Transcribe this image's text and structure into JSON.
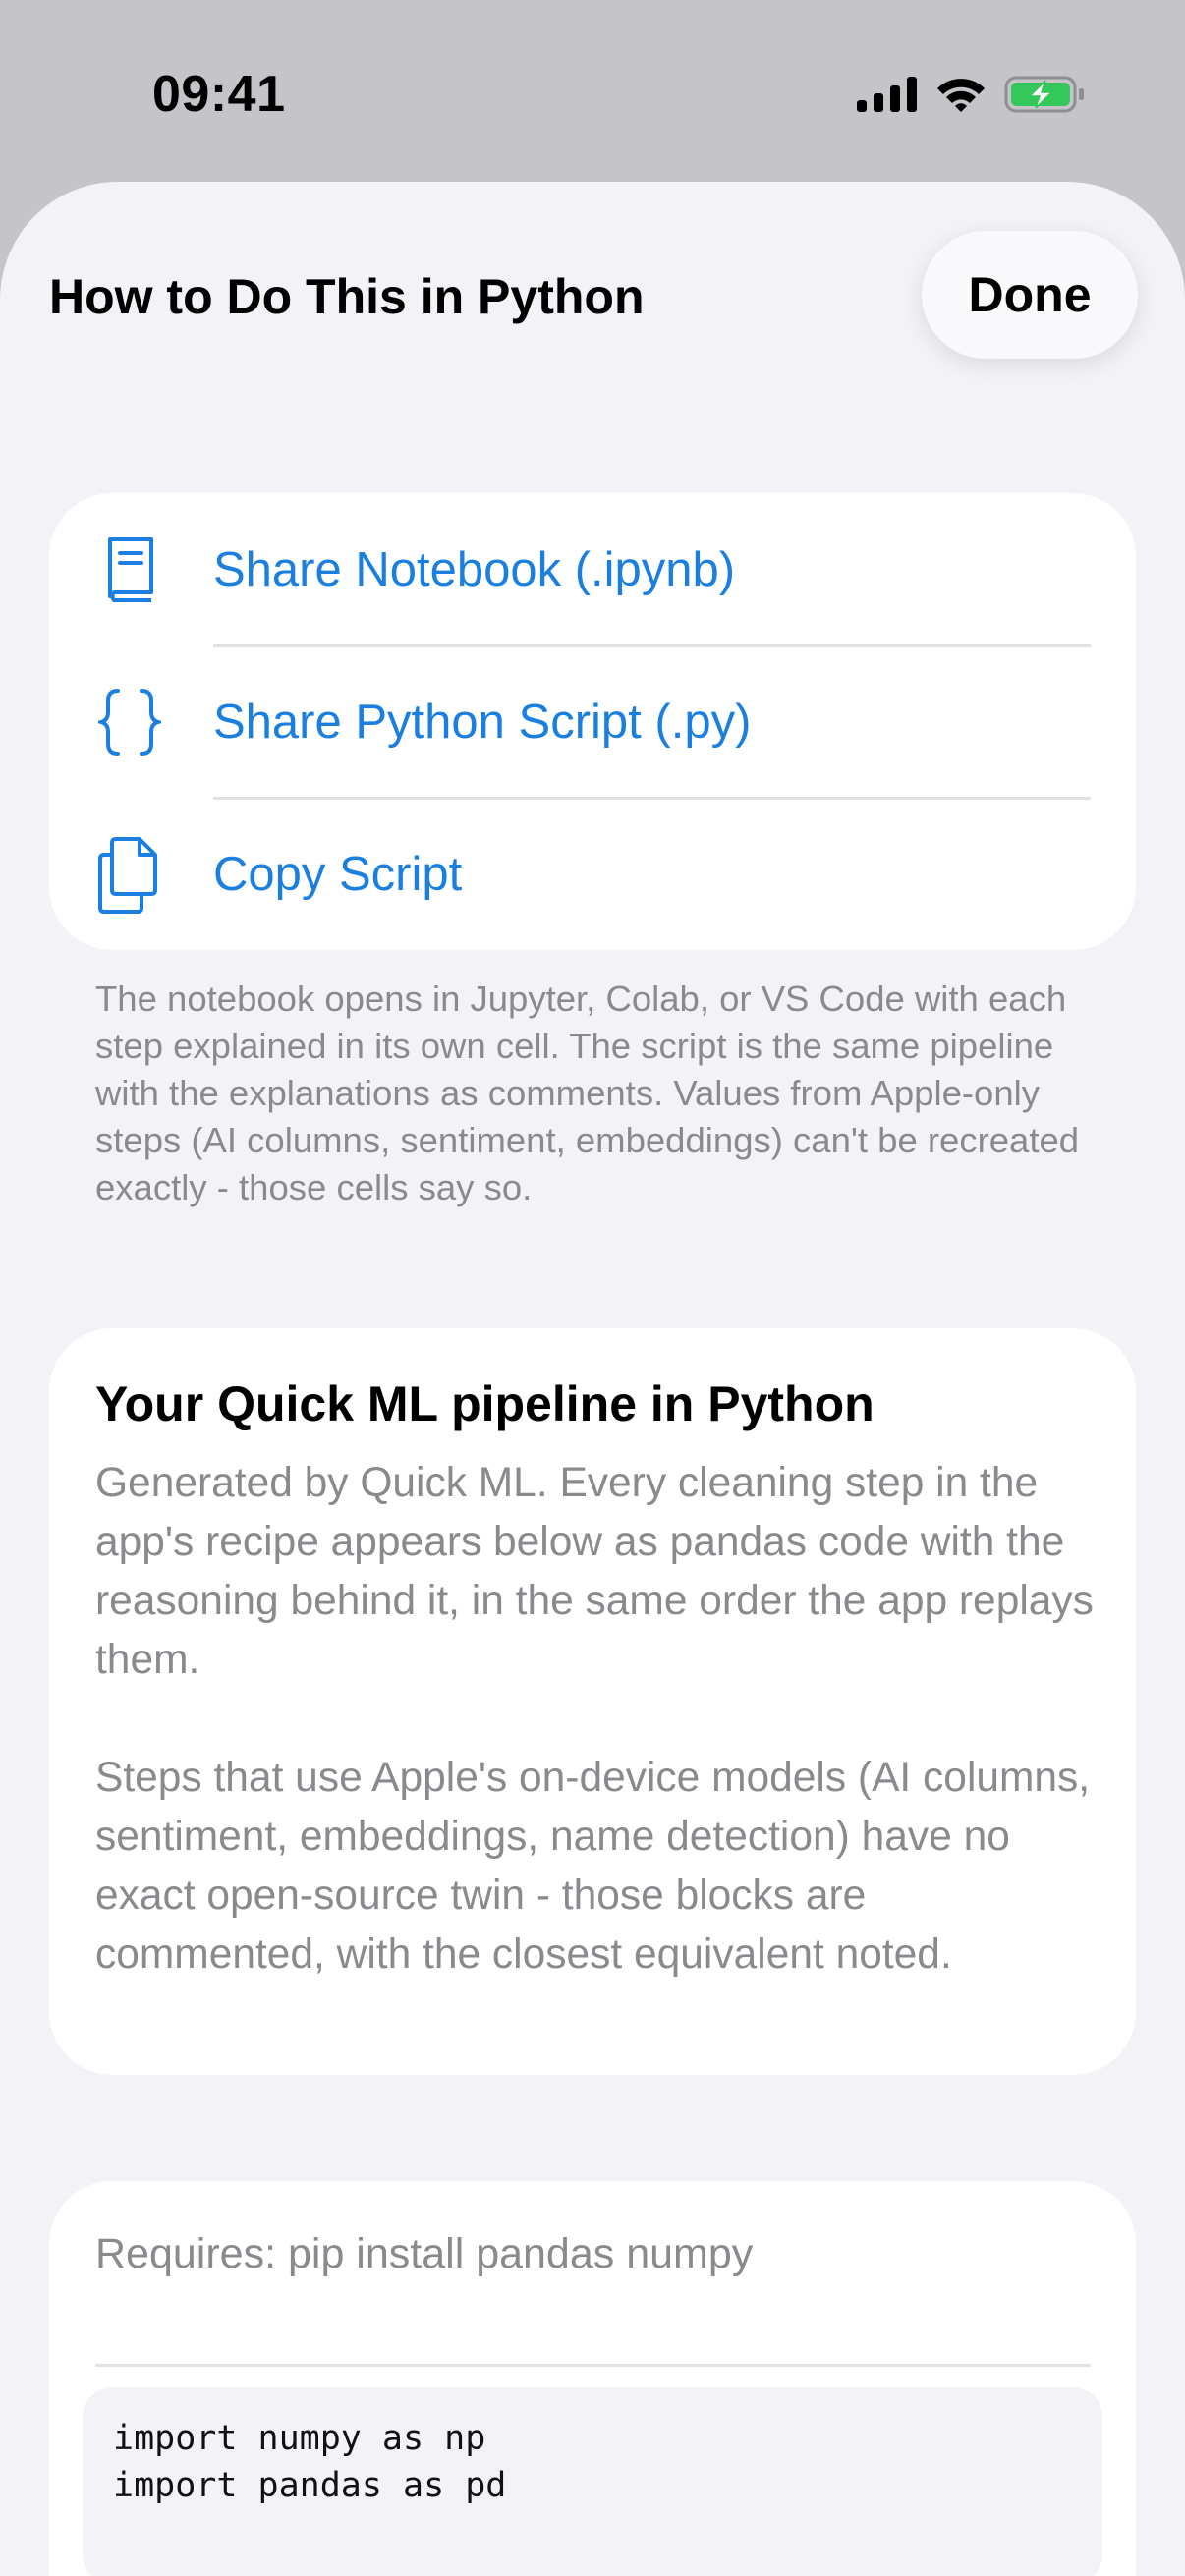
{
  "status_bar": {
    "time": "09:41"
  },
  "sheet": {
    "title": "How to Do This in Python",
    "done_label": "Done"
  },
  "actions": [
    {
      "label": "Share Notebook (.ipynb)",
      "icon": "book-icon"
    },
    {
      "label": "Share Python Script (.py)",
      "icon": "curly-braces-icon"
    },
    {
      "label": "Copy Script",
      "icon": "copy-icon"
    }
  ],
  "footnote": "The notebook opens in Jupyter, Colab, or VS Code with each step explained in its own cell. The script is the same pipeline with the explanations as comments. Values from Apple-only steps (AI columns, sentiment, embeddings) can't be recreated exactly - those cells say so.",
  "explanation": {
    "title": "Your Quick ML pipeline in Python",
    "paragraph_1": "Generated by Quick ML. Every cleaning step in the app's recipe appears below as pandas code with the reasoning behind it, in the same order the app replays them.",
    "paragraph_2": "Steps that use Apple's on-device models (AI columns, sentiment, embeddings, name detection) have no exact open-source twin - those blocks are commented, with the closest equivalent noted."
  },
  "code_card": {
    "requires": "Requires: pip install pandas numpy",
    "lines": [
      "import numpy as np",
      "import pandas as pd"
    ]
  },
  "colors": {
    "accent": "#1a7fe0",
    "secondary_text": "#8a8a8e",
    "sheet_background": "#f2f2f7",
    "battery_green": "#34c759"
  }
}
